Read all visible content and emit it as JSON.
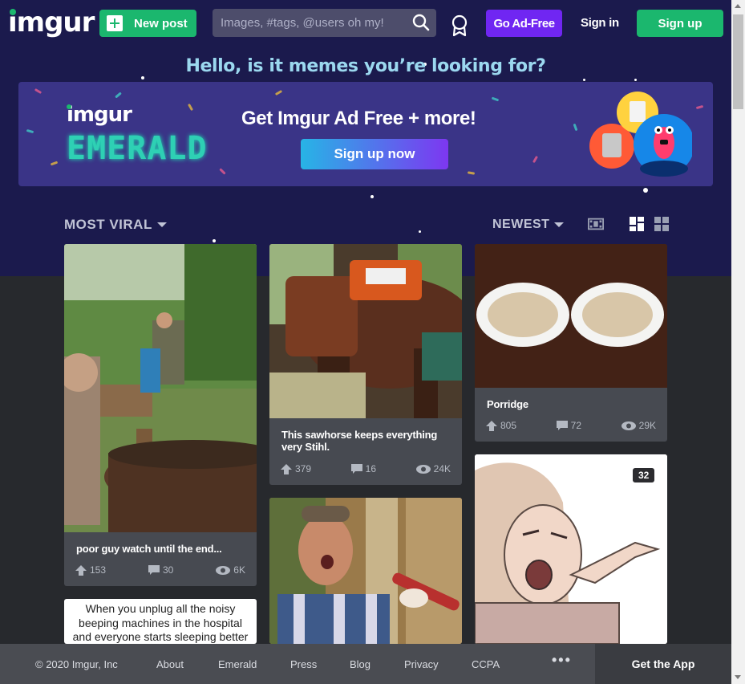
{
  "header": {
    "logo": "imgur",
    "new_post": "New post",
    "search_placeholder": "Images, #tags, @users oh my!",
    "go_ad_free": "Go Ad-Free",
    "sign_in": "Sign in",
    "sign_up": "Sign up"
  },
  "hero": {
    "tagline": "Hello, is it memes you’re looking for?"
  },
  "banner": {
    "brand": "imgur",
    "product": "EMERALD",
    "title": "Get Imgur Ad Free + more!",
    "cta": "Sign up now"
  },
  "sort": {
    "section": "MOST VIRAL",
    "order": "NEWEST"
  },
  "posts": [
    {
      "title": "poor guy watch until the end...",
      "upvotes": "153",
      "comments": "30",
      "views": "6K"
    },
    {
      "title": "This sawhorse keeps everything very Stihl.",
      "upvotes": "379",
      "comments": "16",
      "views": "24K"
    },
    {
      "title": "Porridge",
      "upvotes": "805",
      "comments": "72",
      "views": "29K"
    },
    {
      "caption": "When you unplug all the noisy beeping machines in the hospital and everyone starts sleeping better"
    },
    {
      "title": ""
    },
    {
      "badge": "32"
    }
  ],
  "footer": {
    "copyright": "© 2020 Imgur, Inc",
    "links": [
      "About",
      "Emerald",
      "Press",
      "Blog",
      "Privacy",
      "CCPA"
    ],
    "more": "•••",
    "get_app": "Get the App"
  },
  "colors": {
    "brand_green": "#1bb76e",
    "accent_purple": "#7026f2",
    "hero_bg": "#1b1a4d",
    "page_bg": "#27292d",
    "card_bg": "#474a51"
  }
}
